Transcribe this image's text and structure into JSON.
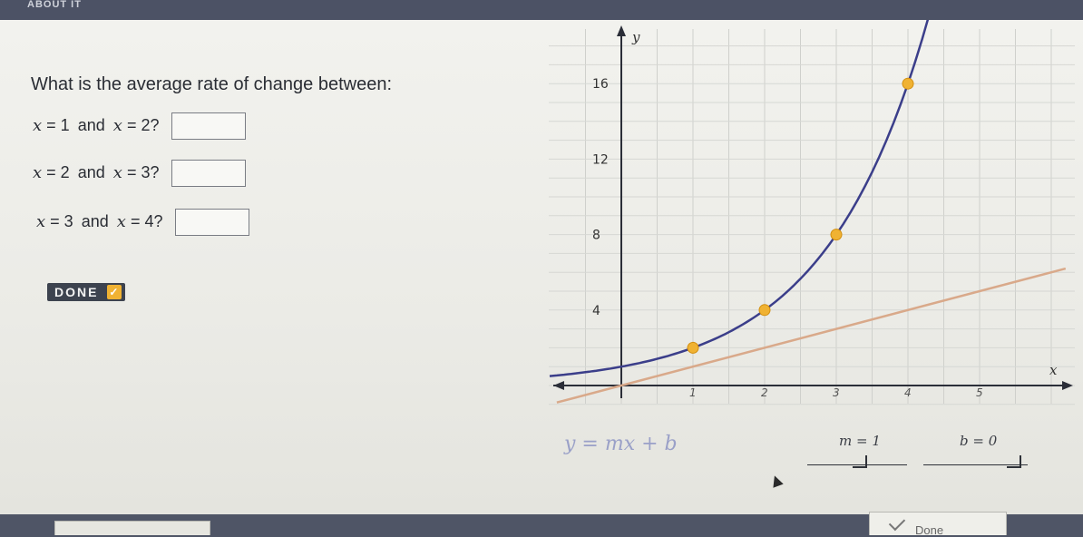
{
  "topbar": {
    "title": "ABOUT IT"
  },
  "question": {
    "prompt": "What is the average rate of change between:"
  },
  "rows": [
    {
      "a_var": "x",
      "a_eq": "= 1",
      "and": "and",
      "b_var": "x",
      "b_eq": "= 2?"
    },
    {
      "a_var": "x",
      "a_eq": "= 2",
      "and": "and",
      "b_var": "x",
      "b_eq": "= 3?"
    },
    {
      "a_var": "x",
      "a_eq": "= 3",
      "and": "and",
      "b_var": "x",
      "b_eq": "= 4?"
    }
  ],
  "done_button": {
    "label": "DONE"
  },
  "graph": {
    "x_axis_label": "x",
    "y_axis_label": "y",
    "x_ticks": [
      "1",
      "2",
      "3",
      "4",
      "5"
    ],
    "y_ticks": [
      "4",
      "8",
      "12",
      "16"
    ],
    "xlim": [
      -1,
      6.2
    ],
    "ylim": [
      -1,
      19
    ],
    "curve_color": "#3b3e8a",
    "line_color": "#d9a98a",
    "point_color": "#f0b232",
    "points": [
      {
        "x": 1,
        "y": 2
      },
      {
        "x": 2,
        "y": 4
      },
      {
        "x": 3,
        "y": 8
      },
      {
        "x": 4,
        "y": 16
      }
    ],
    "line": {
      "m": 1,
      "b": 0
    }
  },
  "equation": {
    "text": "y = mx + b"
  },
  "params": {
    "m_label": "m = 1",
    "b_label": "b = 0"
  },
  "bottom": {
    "done_label": "Done"
  }
}
